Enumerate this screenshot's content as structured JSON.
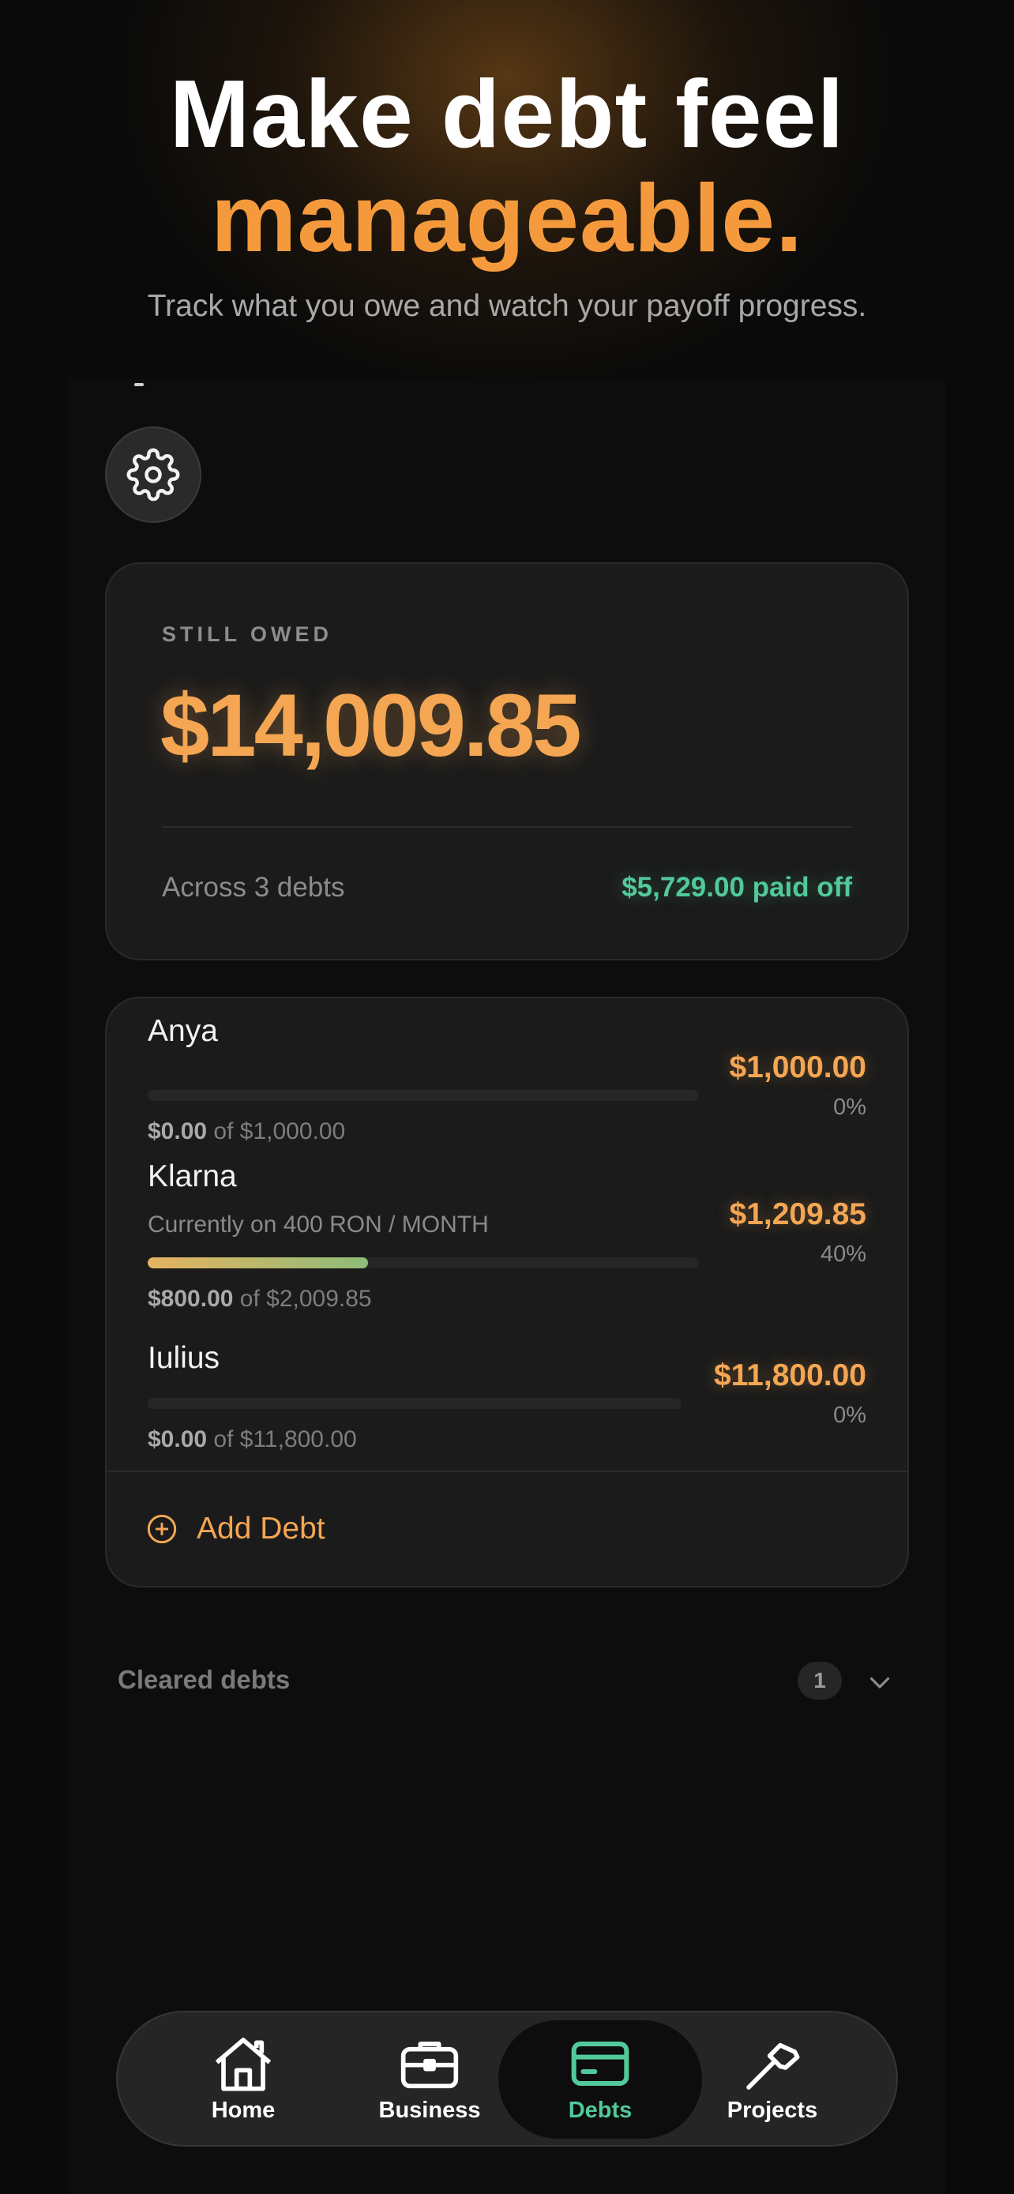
{
  "hero": {
    "headline_line1": "Make debt feel",
    "headline_line2": "manageable.",
    "tagline": "Track what you owe and watch your payoff progress."
  },
  "summary": {
    "eyebrow": "STILL OWED",
    "amount": "$14,009.85",
    "across": "Across 3 debts",
    "paid_off": "$5,729.00 paid off"
  },
  "debts": [
    {
      "name": "Anya",
      "note": "",
      "remaining": "$1,000.00",
      "percent": "0%",
      "progress": 0,
      "paid": "$0.00",
      "of_total": "of $1,000.00"
    },
    {
      "name": "Klarna",
      "note": "Currently on 400 RON / MONTH",
      "remaining": "$1,209.85",
      "percent": "40%",
      "progress": 0.4,
      "paid": "$800.00",
      "of_total": "of $2,009.85"
    },
    {
      "name": "Iulius",
      "note": "",
      "remaining": "$11,800.00",
      "percent": "0%",
      "progress": 0,
      "paid": "$0.00",
      "of_total": "of $11,800.00"
    }
  ],
  "add_debt_label": "Add Debt",
  "cleared": {
    "label": "Cleared debts",
    "count": "1"
  },
  "tabs": [
    {
      "label": "Home",
      "icon": "home-icon"
    },
    {
      "label": "Business",
      "icon": "briefcase-icon"
    },
    {
      "label": "Debts",
      "icon": "card-icon",
      "active": true
    },
    {
      "label": "Projects",
      "icon": "hammer-icon"
    }
  ],
  "colors": {
    "accent": "#f4a653",
    "success": "#52c99a",
    "background": "#0a0a0a"
  }
}
